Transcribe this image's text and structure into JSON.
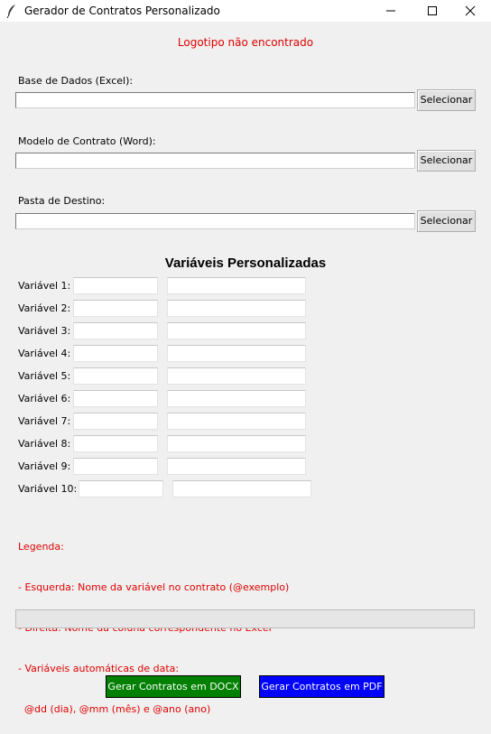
{
  "window": {
    "title": "Gerador de Contratos Personalizado",
    "controls": {
      "minimize": "minimize-icon",
      "maximize": "maximize-icon",
      "close": "close-icon"
    }
  },
  "logo_message": "Logotipo não encontrado",
  "fields": {
    "excel": {
      "label": "Base de Dados (Excel):",
      "value": "",
      "button": "Selecionar"
    },
    "word": {
      "label": "Modelo de Contrato (Word):",
      "value": "",
      "button": "Selecionar"
    },
    "destino": {
      "label": "Pasta de Destino:",
      "value": "",
      "button": "Selecionar"
    }
  },
  "variables": {
    "title": "Variáveis Personalizadas",
    "rows": [
      {
        "label": "Variável 1:",
        "contract_name": "",
        "excel_column": ""
      },
      {
        "label": "Variável 2:",
        "contract_name": "",
        "excel_column": ""
      },
      {
        "label": "Variável 3:",
        "contract_name": "",
        "excel_column": ""
      },
      {
        "label": "Variável 4:",
        "contract_name": "",
        "excel_column": ""
      },
      {
        "label": "Variável 5:",
        "contract_name": "",
        "excel_column": ""
      },
      {
        "label": "Variável 6:",
        "contract_name": "",
        "excel_column": ""
      },
      {
        "label": "Variável 7:",
        "contract_name": "",
        "excel_column": ""
      },
      {
        "label": "Variável 8:",
        "contract_name": "",
        "excel_column": ""
      },
      {
        "label": "Variável 9:",
        "contract_name": "",
        "excel_column": ""
      },
      {
        "label": "Variável 10:",
        "contract_name": "",
        "excel_column": ""
      }
    ]
  },
  "legend": [
    "Legenda:",
    "- Esquerda: Nome da variável no contrato (@exemplo)",
    "- Direita: Nome da coluna correspondente no Excel",
    "- Variáveis automáticas de data:",
    "  @dd (dia), @mm (mês) e @ano (ano)"
  ],
  "progress": {
    "percent": 0
  },
  "actions": {
    "docx": {
      "label": "Gerar Contratos em DOCX",
      "color": "#008000"
    },
    "pdf": {
      "label": "Gerar Contratos em PDF",
      "color": "#0000ff"
    }
  },
  "colors": {
    "warning": "#e00000",
    "window_bg": "#f0f0f0"
  }
}
